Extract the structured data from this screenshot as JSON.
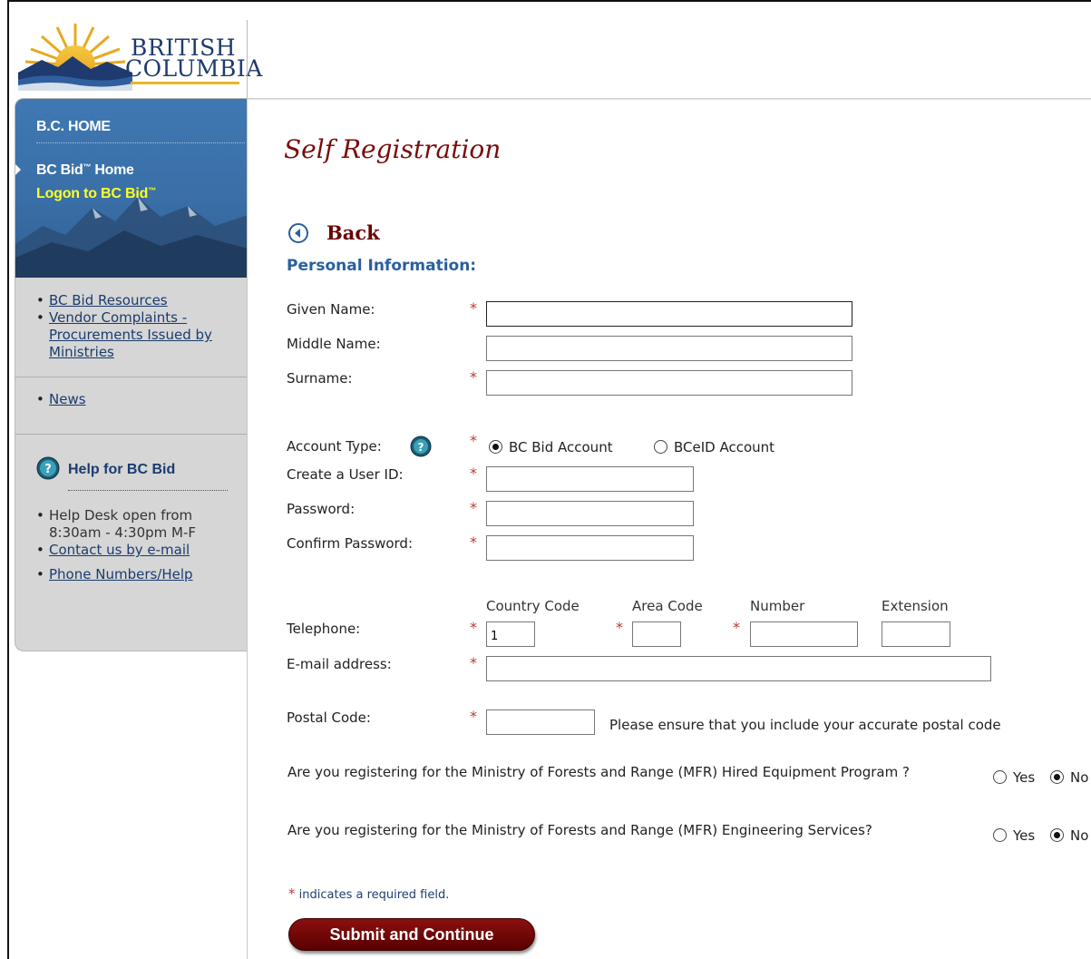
{
  "logo": {
    "line1": "BRITISH",
    "line2": "COLUMBIA"
  },
  "sidebar": {
    "home": "B.C. HOME",
    "bcbid_home": "BC Bid",
    "bcbid_home_suffix": " Home",
    "logon": "Logon to BC Bid",
    "tm": "™",
    "links1": [
      "BC Bid Resources",
      "Vendor Complaints - Procurements Issued by Ministries"
    ],
    "links2": [
      "News"
    ],
    "help_title": "Help for BC Bid",
    "help_text": "Help Desk open from 8:30am - 4:30pm M-F",
    "help_links": [
      "Contact us by e-mail",
      "Phone Numbers/Help"
    ]
  },
  "page": {
    "title": "Self Registration",
    "back": "Back",
    "section": "Personal Information:"
  },
  "form": {
    "given_name_label": "Given Name:",
    "middle_name_label": "Middle Name:",
    "surname_label": "Surname:",
    "account_type_label": "Account Type:",
    "account_option_1": "BC Bid Account",
    "account_option_2": "BCeID Account",
    "user_id_label": "Create a User ID:",
    "password_label": "Password:",
    "confirm_password_label": "Confirm Password:",
    "phone_headers": [
      "Country Code",
      "Area Code",
      "Number",
      "Extension"
    ],
    "telephone_label": "Telephone:",
    "country_code_value": "1",
    "email_label": "E-mail address:",
    "postal_label": "Postal Code:",
    "postal_note": "Please ensure that you include your accurate postal code",
    "q1": "Are you registering for the Ministry of Forests and Range (MFR) Hired Equipment Program ?",
    "q2": "Are you registering for the Ministry of Forests and Range (MFR) Engineering Services?",
    "yes": "Yes",
    "no": "No",
    "required_mark": "*",
    "required_note": "indicates a required field.",
    "submit": "Submit and Continue"
  },
  "colors": {
    "title": "#7a0c0c",
    "section": "#2a5fa0",
    "required": "#c0392b",
    "sidebar_blue": "#3a6fa7",
    "logon_yellow": "#ffff22"
  }
}
